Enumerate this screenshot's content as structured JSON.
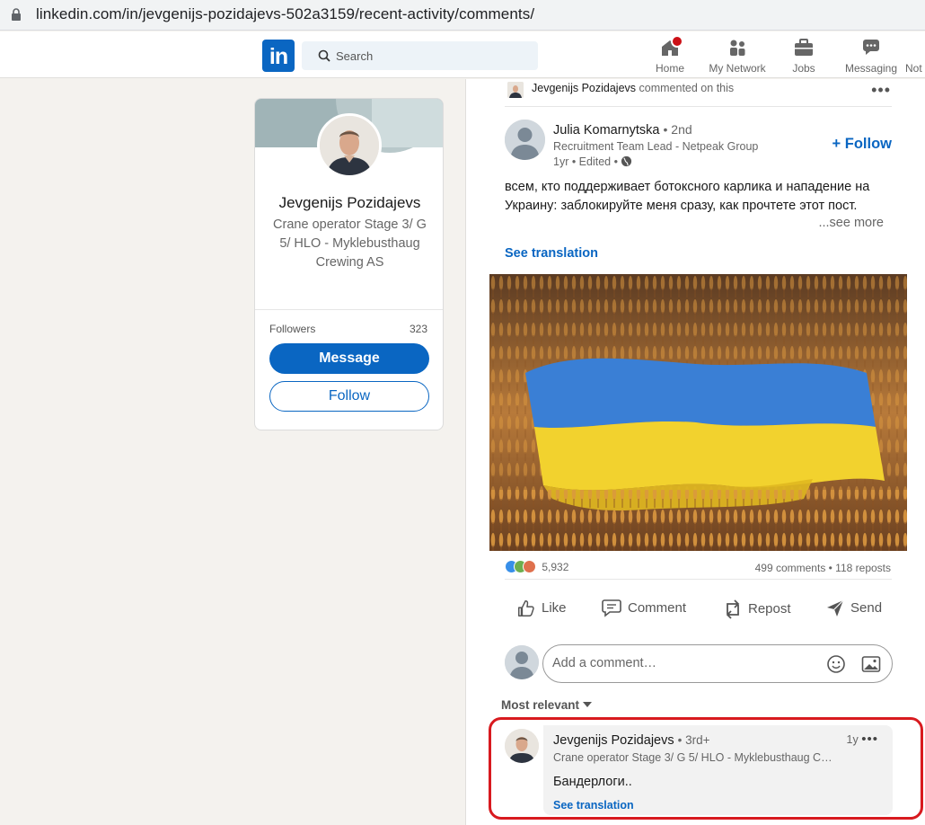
{
  "browser": {
    "url": "linkedin.com/in/jevgenijs-pozidajevs-502a3159/recent-activity/comments/"
  },
  "nav": {
    "logo": "in",
    "search_placeholder": "Search",
    "items": [
      {
        "label": "Home",
        "icon": "home-icon"
      },
      {
        "label": "My Network",
        "icon": "network-icon"
      },
      {
        "label": "Jobs",
        "icon": "briefcase-icon"
      },
      {
        "label": "Messaging",
        "icon": "messaging-icon"
      },
      {
        "label": "Not",
        "icon": "bell-icon"
      }
    ]
  },
  "profile": {
    "name": "Jevgenijs Pozidajevs",
    "headline": "Crane operator Stage 3/ G 5/ HLO - Myklebusthaug Crewing AS",
    "followers_label": "Followers",
    "followers_count": "323",
    "message_label": "Message",
    "follow_label": "Follow"
  },
  "post": {
    "activity_actor": "Jevgenijs Pozidajevs",
    "activity_text": "commented on this",
    "author": {
      "name": "Julia Komarnytska",
      "degree": "• 2nd",
      "headline": "Recruitment Team Lead - Netpeak Group",
      "time": "1yr • Edited •"
    },
    "follow_label": "+ Follow",
    "text": "всем, кто поддерживает ботоксного карлика и нападение на Украину: заблокируйте меня сразу, как прочтете этот пост.",
    "see_more": "...see more",
    "see_translation": "See translation",
    "reactions_count": "5,932",
    "counts": "499 comments • 118 reposts",
    "actions": [
      "Like",
      "Comment",
      "Repost",
      "Send"
    ],
    "comment_placeholder": "Add a comment…",
    "sort_label": "Most relevant"
  },
  "comment": {
    "name": "Jevgenijs Pozidajevs",
    "degree": "• 3rd+",
    "headline": "Crane operator Stage 3/ G 5/ HLO - Myklebusthaug C…",
    "time": "1y",
    "text": "Бандерлоги..",
    "see_translation": "See translation"
  },
  "colors": {
    "brand": "#0a66c2",
    "highlight": "#d81a1f",
    "flag_blue": "#3a7fd5",
    "flag_yellow": "#f2d22e"
  }
}
